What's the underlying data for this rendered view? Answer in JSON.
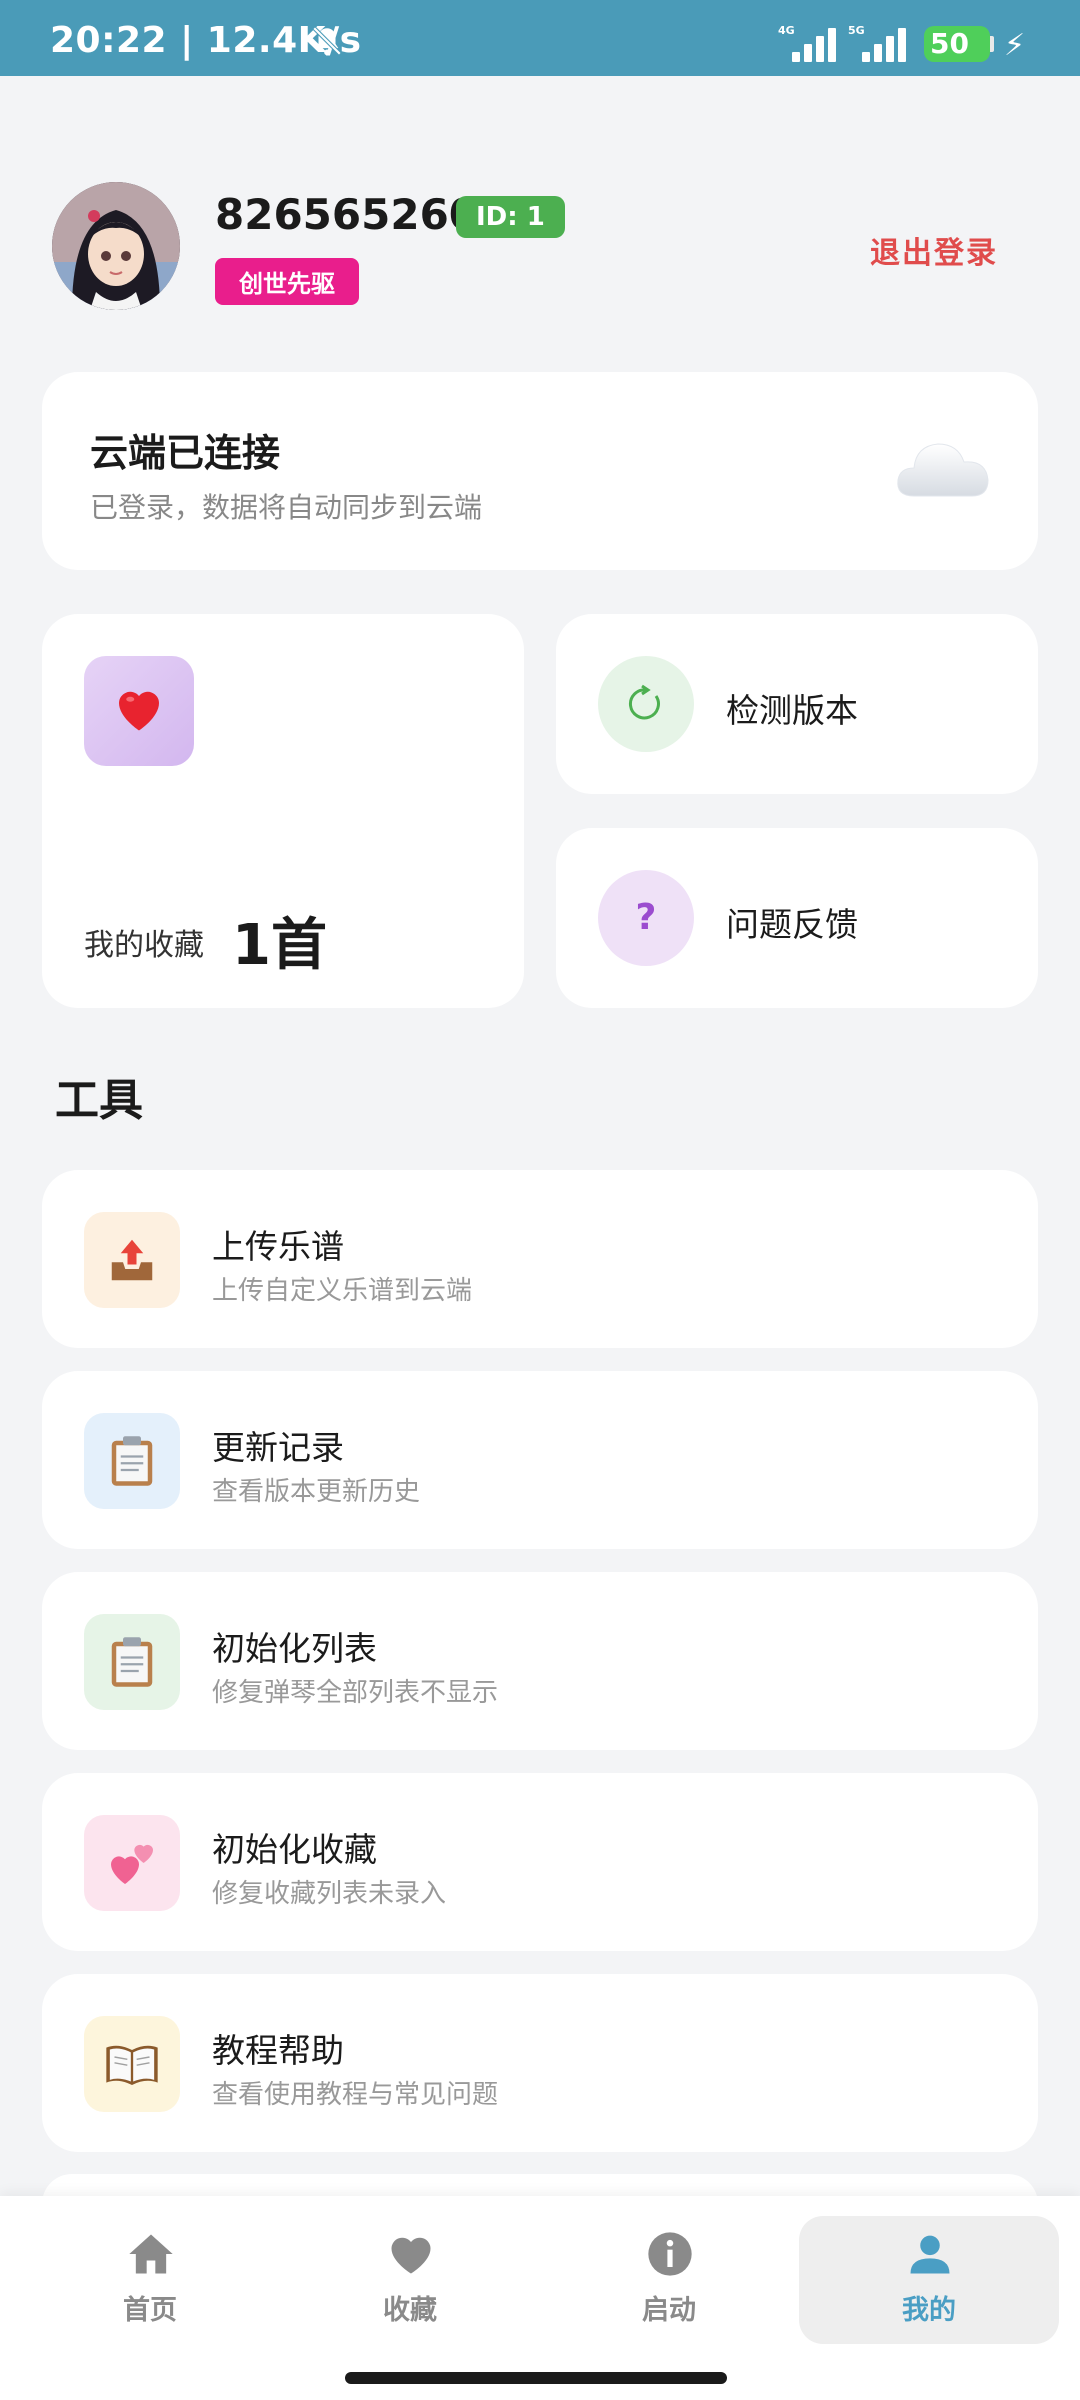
{
  "status_bar": {
    "time_speed": "20:22 | 12.4K/s",
    "sim1_label": "4G",
    "sim2_label": "5G",
    "battery": "50",
    "icons": [
      "bell-muted-icon",
      "signal-icon",
      "battery-icon",
      "charging-icon"
    ]
  },
  "profile": {
    "username": "826565260",
    "id_badge": "ID: 1",
    "role_badge": "创世先驱",
    "logout_label": "退出登录"
  },
  "cloud": {
    "title": "云端已连接",
    "subtitle": "已登录，数据将自动同步到云端",
    "icon": "cloud-icon"
  },
  "favorites": {
    "label": "我的收藏",
    "count": "1首",
    "icon": "heart-icon"
  },
  "quick_actions": [
    {
      "label": "检测版本",
      "icon": "refresh-icon"
    },
    {
      "label": "问题反馈",
      "icon": "question-icon"
    }
  ],
  "tools_section": {
    "title": "工具",
    "items": [
      {
        "title": "上传乐谱",
        "subtitle": "上传自定义乐谱到云端",
        "icon": "upload-tray-icon"
      },
      {
        "title": "更新记录",
        "subtitle": "查看版本更新历史",
        "icon": "clipboard-icon"
      },
      {
        "title": "初始化列表",
        "subtitle": "修复弹琴全部列表不显示",
        "icon": "clipboard-icon"
      },
      {
        "title": "初始化收藏",
        "subtitle": "修复收藏列表未录入",
        "icon": "two-hearts-icon"
      },
      {
        "title": "教程帮助",
        "subtitle": "查看使用教程与常见问题",
        "icon": "book-icon"
      }
    ]
  },
  "bottom_nav": {
    "items": [
      {
        "label": "首页",
        "icon": "home-icon",
        "active": false
      },
      {
        "label": "收藏",
        "icon": "heart-icon",
        "active": false
      },
      {
        "label": "启动",
        "icon": "info-icon",
        "active": false
      },
      {
        "label": "我的",
        "icon": "person-icon",
        "active": true
      }
    ]
  },
  "colors": {
    "status_bar": "#4a9bb8",
    "id_badge": "#4caf50",
    "role_badge": "#e91e8c",
    "logout": "#e04c4c",
    "nav_active": "#4a9ec4",
    "background": "#f3f4f6"
  }
}
